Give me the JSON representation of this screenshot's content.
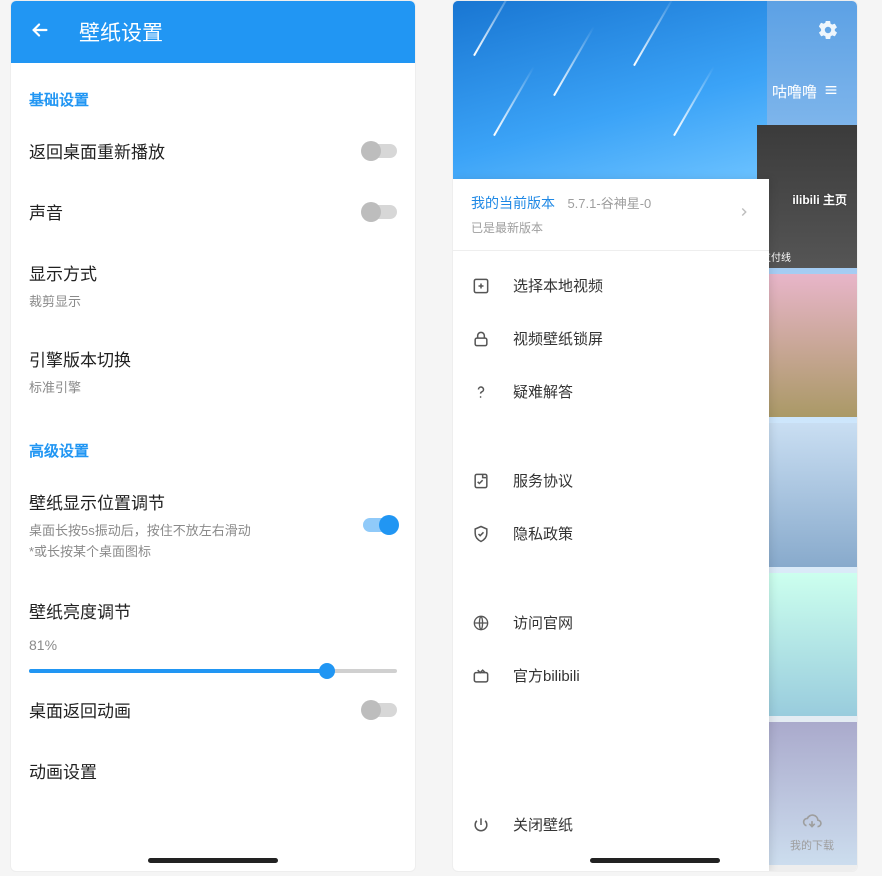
{
  "left": {
    "appbar_title": "壁纸设置",
    "section_basic": "基础设置",
    "section_advanced": "高级设置",
    "rows": {
      "restart_on_desktop": {
        "title": "返回桌面重新播放"
      },
      "sound": {
        "title": "声音"
      },
      "display_mode": {
        "title": "显示方式",
        "sub": "裁剪显示"
      },
      "engine_version": {
        "title": "引擎版本切换",
        "sub": "标准引擎"
      },
      "position_adjust": {
        "title": "壁纸显示位置调节",
        "sub1": "桌面长按5s振动后，按住不放左右滑动",
        "sub2": "*或长按某个桌面图标"
      },
      "brightness": {
        "title": "壁纸亮度调节",
        "value": "81%"
      },
      "return_anim": {
        "title": "桌面返回动画"
      },
      "anim_settings": {
        "title": "动画设置"
      }
    }
  },
  "right": {
    "tab": "咕噜噜",
    "bilibili_tag": "ilibili 主页",
    "version_label": "我的当前版本",
    "version_number": "5.7.1-谷神星-0",
    "version_status": "已是最新版本",
    "menu": {
      "select_local_video": "选择本地视频",
      "lock_screen": "视频壁纸锁屏",
      "faq": "疑难解答",
      "tos": "服务协议",
      "privacy": "隐私政策",
      "website": "访问官网",
      "bilibili": "官方bilibili",
      "close_wallpaper": "关闭壁纸"
    },
    "download_label": "我的下载"
  }
}
